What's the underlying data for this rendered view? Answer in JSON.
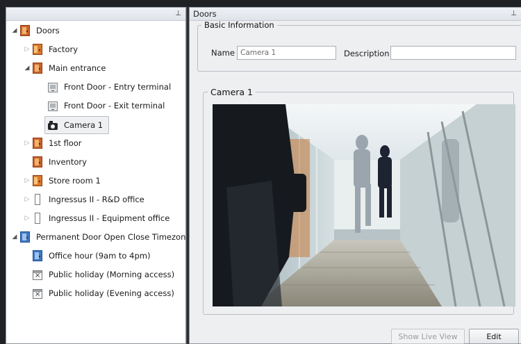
{
  "left_panel": {
    "tree": [
      {
        "label": "Doors",
        "icon": "door-icon",
        "expander": "expanded"
      },
      {
        "label": "Factory",
        "icon": "door-icon",
        "expander": "collapsed"
      },
      {
        "label": "Main entrance",
        "icon": "door-icon",
        "expander": "expanded"
      },
      {
        "label": "Front Door - Entry terminal",
        "icon": "terminal-icon",
        "expander": "none"
      },
      {
        "label": "Front Door - Exit terminal",
        "icon": "terminal-icon",
        "expander": "none"
      },
      {
        "label": "Camera 1",
        "icon": "camera-icon",
        "expander": "none",
        "selected": true
      },
      {
        "label": "1st floor",
        "icon": "door-icon",
        "expander": "collapsed"
      },
      {
        "label": "Inventory",
        "icon": "door-icon",
        "expander": "none"
      },
      {
        "label": "Store room 1",
        "icon": "door-icon",
        "expander": "collapsed"
      },
      {
        "label": "Ingressus II - R&D office",
        "icon": "door-icon",
        "expander": "collapsed"
      },
      {
        "label": "Ingressus II - Equipment office",
        "icon": "door-icon",
        "expander": "collapsed"
      },
      {
        "label": "Permanent Door Open Close Timezone",
        "icon": "timezone-icon",
        "expander": "expanded"
      },
      {
        "label": "Office hour (9am to 4pm)",
        "icon": "timezone-icon",
        "expander": "none"
      },
      {
        "label": "Public holiday (Morning access)",
        "icon": "calendar-icon",
        "expander": "none"
      },
      {
        "label": "Public holiday (Evening access)",
        "icon": "calendar-icon",
        "expander": "none"
      }
    ]
  },
  "right_panel": {
    "title": "Doors",
    "basic_info": {
      "legend": "Basic Information",
      "name_label": "Name",
      "name_value": "Camera 1",
      "description_label": "Description",
      "description_value": ""
    },
    "camera": {
      "legend": "Camera 1"
    },
    "buttons": {
      "show_live_view": "Show Live View",
      "edit": "Edit"
    }
  },
  "colors": {
    "background": "#1f2125",
    "panel": "#ffffff",
    "door_icon": "#c9632a",
    "timezone_icon": "#3f78c4"
  }
}
